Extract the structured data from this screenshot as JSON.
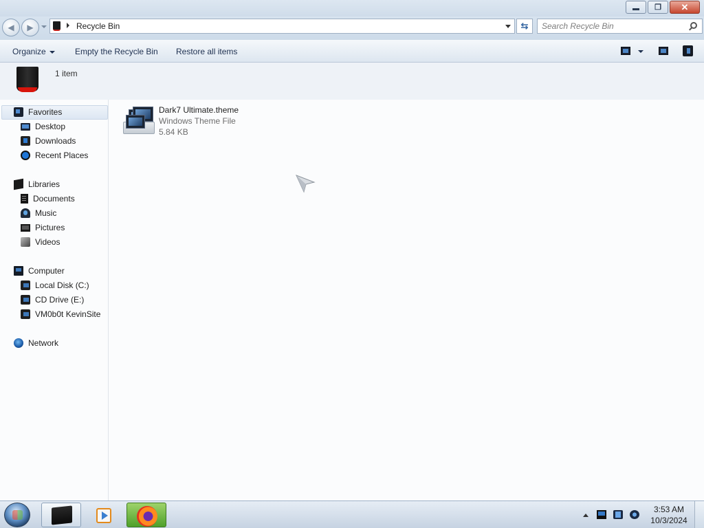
{
  "window": {
    "minimize_icon": "minimize-icon",
    "maximize_icon": "restore-icon",
    "close_icon": "close-icon"
  },
  "address": {
    "location": "Recycle Bin",
    "search_placeholder": "Search Recycle Bin"
  },
  "commandbar": {
    "organize": "Organize",
    "empty": "Empty the Recycle Bin",
    "restore": "Restore all items"
  },
  "info": {
    "item_count": "1 item"
  },
  "nav": {
    "favorites": {
      "label": "Favorites",
      "items": [
        "Desktop",
        "Downloads",
        "Recent Places"
      ]
    },
    "libraries": {
      "label": "Libraries",
      "items": [
        "Documents",
        "Music",
        "Pictures",
        "Videos"
      ]
    },
    "computer": {
      "label": "Computer",
      "items": [
        "Local Disk (C:)",
        "CD Drive (E:)",
        "VM0b0t KevinSite"
      ]
    },
    "network": {
      "label": "Network"
    }
  },
  "files": [
    {
      "name": "Dark7 Ultimate.theme",
      "type": "Windows Theme File",
      "size": "5.84 KB"
    }
  ],
  "taskbar": {
    "time": "3:53 AM",
    "date": "10/3/2024"
  },
  "colors": {
    "taskbar_firefox_active": "#4ea02a",
    "close_button": "#c6472f",
    "recycle_bin_band": "#d8150c"
  }
}
